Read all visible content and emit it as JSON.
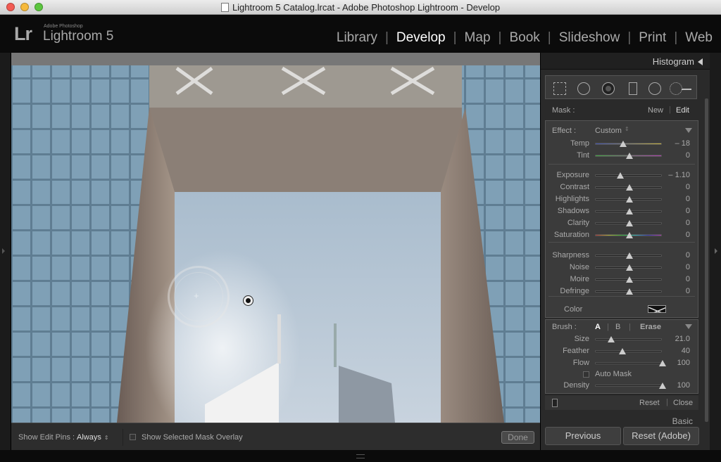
{
  "window": {
    "title": "Lightroom 5 Catalog.lrcat - Adobe Photoshop Lightroom - Develop"
  },
  "brand": {
    "small": "Adobe Photoshop",
    "name": "Lightroom 5",
    "logo": "Lr"
  },
  "modules": [
    {
      "label": "Library",
      "active": false
    },
    {
      "label": "Develop",
      "active": true
    },
    {
      "label": "Map",
      "active": false
    },
    {
      "label": "Book",
      "active": false
    },
    {
      "label": "Slideshow",
      "active": false
    },
    {
      "label": "Print",
      "active": false
    },
    {
      "label": "Web",
      "active": false
    }
  ],
  "panel": {
    "histogram": "Histogram",
    "tools": [
      "crop-overlay-icon",
      "spot-removal-icon",
      "red-eye-icon",
      "graduated-filter-icon",
      "radial-filter-icon",
      "adjustment-brush-icon"
    ],
    "mask": {
      "label": "Mask :",
      "new": "New",
      "edit": "Edit"
    },
    "effect": {
      "label": "Effect :",
      "preset": "Custom"
    },
    "sliders": [
      {
        "label": "Temp",
        "value": "– 18",
        "level": 0.41
      },
      {
        "label": "Tint",
        "value": "0",
        "level": 0.5
      },
      {
        "label": "Exposure",
        "value": "– 1.10",
        "level": 0.37
      },
      {
        "label": "Contrast",
        "value": "0",
        "level": 0.5
      },
      {
        "label": "Highlights",
        "value": "0",
        "level": 0.5
      },
      {
        "label": "Shadows",
        "value": "0",
        "level": 0.5
      },
      {
        "label": "Clarity",
        "value": "0",
        "level": 0.5
      },
      {
        "label": "Saturation",
        "value": "0",
        "level": 0.5
      },
      {
        "label": "Sharpness",
        "value": "0",
        "level": 0.5
      },
      {
        "label": "Noise",
        "value": "0",
        "level": 0.5
      },
      {
        "label": "Moire",
        "value": "0",
        "level": 0.5
      },
      {
        "label": "Defringe",
        "value": "0",
        "level": 0.5
      }
    ],
    "color_label": "Color",
    "brush": {
      "label": "Brush :",
      "a": "A",
      "b": "B",
      "erase": "Erase",
      "size": {
        "label": "Size",
        "value": "21.0",
        "level": 0.23
      },
      "feather": {
        "label": "Feather",
        "value": "40",
        "level": 0.4
      },
      "flow": {
        "label": "Flow",
        "value": "100",
        "level": 1.0
      },
      "automask": "Auto Mask",
      "density": {
        "label": "Density",
        "value": "100",
        "level": 1.0
      }
    },
    "reset": "Reset",
    "close": "Close",
    "basic": "Basic",
    "previous": "Previous",
    "reset_adobe": "Reset (Adobe)"
  },
  "toolbar": {
    "show_pins_label": "Show Edit Pins :",
    "show_pins_value": "Always",
    "overlay_label": "Show Selected Mask Overlay",
    "done": "Done"
  }
}
